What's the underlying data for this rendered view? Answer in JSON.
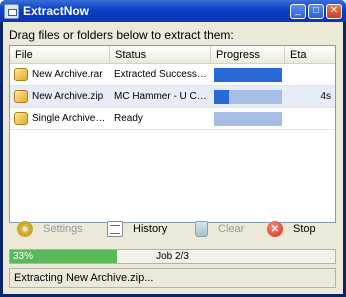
{
  "window": {
    "title": "ExtractNow",
    "min_glyph": "_",
    "max_glyph": "□",
    "close_glyph": "✕"
  },
  "instructions": "Drag files or folders below to extract them:",
  "list": {
    "columns": [
      "File",
      "Status",
      "Progress",
      "Eta"
    ],
    "rows": [
      {
        "file": "New Archive.rar",
        "status": "Extracted Successfull...",
        "progress": 1.0,
        "eta": ""
      },
      {
        "file": "New Archive.zip",
        "status": "MC Hammer - U Can'...",
        "progress": 0.22,
        "eta": "4s"
      },
      {
        "file": "Single Archive.r...",
        "status": "Ready",
        "progress": 0.0,
        "eta": ""
      }
    ]
  },
  "toolbar": {
    "settings": {
      "label": "Settings",
      "icon": "gear-icon",
      "enabled": false
    },
    "history": {
      "label": "History",
      "icon": "history-icon",
      "enabled": true
    },
    "clear": {
      "label": "Clear",
      "icon": "trash-icon",
      "enabled": false
    },
    "stop": {
      "label": "Stop",
      "icon": "stop-icon",
      "enabled": true,
      "glyph": "✕"
    }
  },
  "overall": {
    "percent_label": "33%",
    "percent": 33,
    "job_label": "Job 2/3"
  },
  "status_text": "Extracting New Archive.zip...",
  "colors": {
    "titlebar": "#0a3ec6",
    "progress_fill": "#2a68d8",
    "progress_track": "#a8bde6",
    "overall_fill": "#5aba5a",
    "stop_red": "#d42a14"
  }
}
